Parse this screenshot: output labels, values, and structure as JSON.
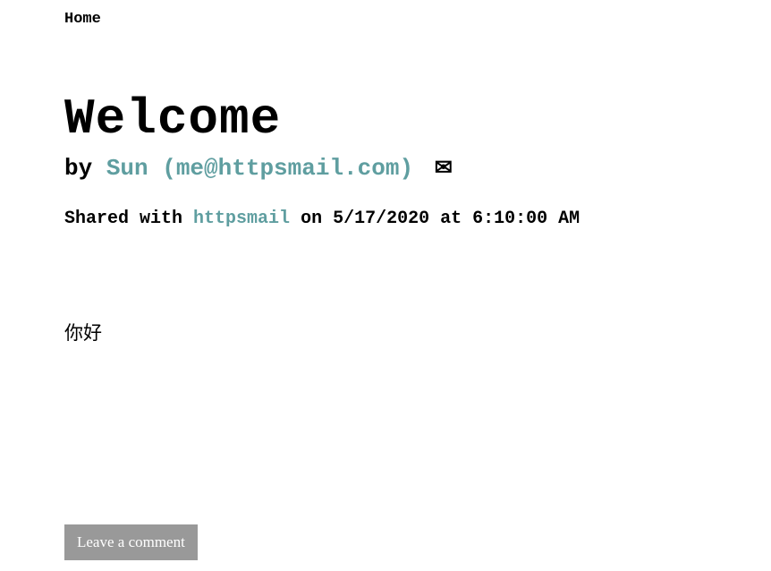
{
  "nav": {
    "home": "Home"
  },
  "post": {
    "title": "Welcome",
    "byline_prefix": "by ",
    "author_text": "Sun (me@httpsmail.com)",
    "shared_prefix": "Shared with ",
    "shared_site": "httpsmail",
    "shared_suffix": " on 5/17/2020 at 6:10:00 AM",
    "body": "你好"
  },
  "actions": {
    "leave_comment": "Leave a comment"
  }
}
